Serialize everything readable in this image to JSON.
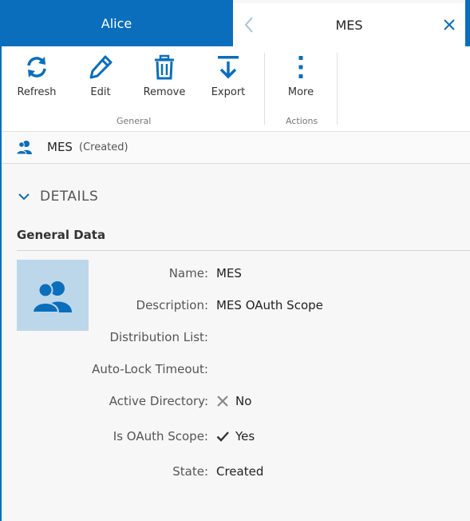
{
  "tabs": {
    "left_label": "Alice",
    "active_label": "MES"
  },
  "toolbar": {
    "refresh_label": "Refresh",
    "edit_label": "Edit",
    "remove_label": "Remove",
    "export_label": "Export",
    "more_label": "More",
    "group_general": "General",
    "group_actions": "Actions"
  },
  "breadcrumb": {
    "name": "MES",
    "state": "(Created)"
  },
  "details": {
    "header": "DETAILS",
    "section_title": "General Data",
    "fields": [
      {
        "label": "Name:",
        "value": "MES"
      },
      {
        "label": "Description:",
        "value": "MES OAuth Scope"
      },
      {
        "label": "Distribution List:",
        "value": ""
      },
      {
        "label": "Auto-Lock Timeout:",
        "value": ""
      },
      {
        "label": "Active Directory:",
        "value": "No"
      },
      {
        "label": "Is OAuth Scope:",
        "value": "Yes"
      },
      {
        "label": "State:",
        "value": "Created"
      }
    ]
  },
  "colors": {
    "accent": "#0a6ebd",
    "avatar_bg": "#bdd7ea",
    "avatar_icon": "#0a6ebd"
  },
  "icons": [
    "chevron-left-icon",
    "close-icon",
    "refresh-icon",
    "pencil-icon",
    "trash-icon",
    "export-icon",
    "more-vertical-icon",
    "users-icon",
    "chevron-down-icon",
    "x-icon",
    "check-icon"
  ]
}
